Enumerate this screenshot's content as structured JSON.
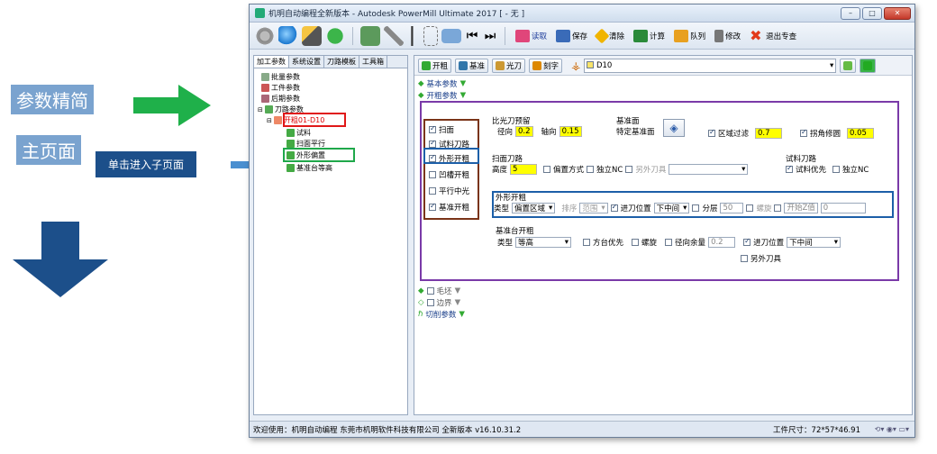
{
  "annotations": {
    "params_simplify": "参数精简",
    "main_page": "主页面",
    "click_enter": "单击进入子页面"
  },
  "window": {
    "title": "机明自动编程全新版本 - Autodesk PowerMill Ultimate 2017   [ - 无 ]",
    "min": "–",
    "max": "□",
    "close": "✕"
  },
  "toolbar": {
    "items": [
      {
        "label": "",
        "icon": "gear-icon"
      },
      {
        "label": "",
        "icon": "globe-icon"
      },
      {
        "label": "",
        "icon": "broom-icon"
      },
      {
        "label": "",
        "icon": "add-icon"
      },
      {
        "label": "",
        "icon": "grid-icon"
      },
      {
        "label": "",
        "icon": "wrench-icon"
      },
      {
        "label": "",
        "icon": "arrow-icon"
      },
      {
        "label": "",
        "icon": "tree-icon"
      },
      {
        "label": "",
        "icon": "folder-icon"
      },
      {
        "label": "",
        "icon": "first-icon"
      },
      {
        "label": "",
        "icon": "last-icon"
      }
    ],
    "read": "读取",
    "save": "保存",
    "clear": "清除",
    "calc": "计算",
    "queue": "队列",
    "modify": "修改",
    "exit": "退出专查"
  },
  "left_tabs": [
    "加工参数",
    "系统设置",
    "刀路模板",
    "工具箱"
  ],
  "tree": {
    "batch": "批量参数",
    "work": "工件参数",
    "post": "后期参数",
    "tool": "刀路参数",
    "rough": "开粗01-D10",
    "trial": "试料",
    "face": "扫面平行",
    "outer": "外形偏置",
    "base": "基准台等高"
  },
  "rp_toolbar": {
    "rough": "开粗",
    "base": "基准",
    "finish": "光刀",
    "engrave": "刻字",
    "tool": "D10"
  },
  "sections": {
    "basic": "基本参数",
    "rough": "开粗参数",
    "blank": "毛坯",
    "boundary": "边界",
    "cut": "切削参数"
  },
  "left_checks": [
    {
      "label": "扫面",
      "on": true
    },
    {
      "label": "试料刀路",
      "on": true
    },
    {
      "label": "外形开粗",
      "on": true
    },
    {
      "label": "凹槽开粗",
      "on": false
    },
    {
      "label": "平行中光",
      "on": false
    },
    {
      "label": "基准开粗",
      "on": true
    }
  ],
  "finish_allow": {
    "title": "比光刀预留",
    "radial_label": "径向",
    "radial": "0.2",
    "axial_label": "轴向",
    "axial": "0.15"
  },
  "base_face": {
    "title": "基准面",
    "label": "特定基准面"
  },
  "region_filter": {
    "label": "区域过滤",
    "value": "0.7"
  },
  "corner": {
    "label": "拐角修圆",
    "value": "0.05"
  },
  "face_path": {
    "title": "扫面刀路",
    "height_label": "高度",
    "height": "5",
    "offset_label": "偏置方式",
    "indep_label": "独立NC",
    "other_tool": "另外刀具"
  },
  "trial_path": {
    "title": "试料刀路",
    "trial_first": "试料优先",
    "indep": "独立NC"
  },
  "outer_rough": {
    "title": "外形开粗",
    "type_label": "类型",
    "type": "偏置区域",
    "order_label": "排序",
    "order": "范围",
    "entry_label": "进刀位置",
    "entry": "下中间",
    "layer_label": "分层",
    "layer": "50",
    "spiral_label": "螺旋",
    "start_z": "开始Z值",
    "start_z_val": "0"
  },
  "base_rough": {
    "title": "基准台开粗",
    "type_label": "类型",
    "type": "等高",
    "square_first": "方台优先",
    "spiral": "螺旋",
    "radial_label": "径向余量",
    "radial": "0.2",
    "entry_label": "进刀位置",
    "entry": "下中间",
    "other_tool": "另外刀具"
  },
  "status": {
    "welcome": "欢迎使用：机明自动编程 东莞市机明软件科技有限公司 全新版本 v16.10.31.2",
    "size_label": "工件尺寸：",
    "size": "72*57*46.91"
  }
}
